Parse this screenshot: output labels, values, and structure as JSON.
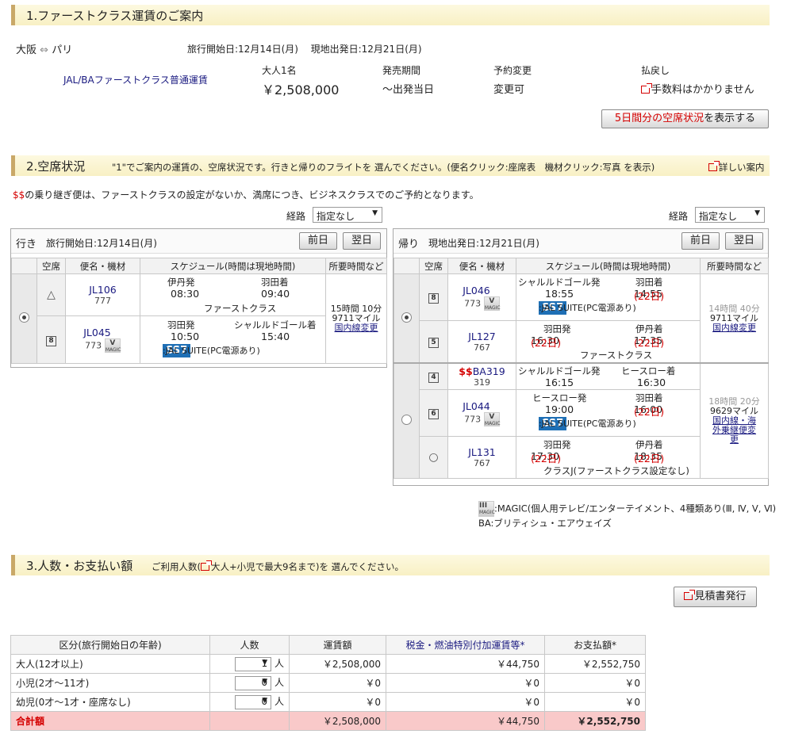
{
  "sections": {
    "s1": {
      "title": "1.ファーストクラス運賃のご案内"
    },
    "s2": {
      "title": "2.空席状況",
      "instruction": "\"1\"でご案内の運賃の、空席状況です。行きと帰りのフライトを 選んでください。(便名クリック:座席表　機材クリック:写真 を表示)",
      "details_link": "詳しい案内"
    },
    "s3": {
      "title": "3.人数・お支払い額",
      "note_pre": "ご利用人数(",
      "note_link": "大人+小児で最大9名まで",
      "note_post": ")を 選んでください。"
    }
  },
  "route": {
    "from": "大阪",
    "arrow": "⇔",
    "to": "パリ"
  },
  "dates": {
    "depart_label": "旅行開始日:",
    "depart": "12月14日(月)",
    "return_label": "現地出発日:",
    "return": "12月21日(月)"
  },
  "fare": {
    "name": "JAL/BAファーストクラス普通運賃",
    "col1_label": "大人1名",
    "col1_value": "￥2,508,000",
    "col2_label": "発売期間",
    "col2_value": "～出発当日",
    "col3_label": "予約変更",
    "col3_value": "変更可",
    "col4_label": "払戻し",
    "col4_value": "手数料はかかりません"
  },
  "availability_button": {
    "label_red": "5日間分の空席状況",
    "label_rest": "を表示する"
  },
  "notice": {
    "marks": "$$",
    "text": "の乗り継ぎ便は、ファーストクラスの設定がないか、満席につき、ビジネスクラスでのご予約となります。"
  },
  "route_filter": {
    "label": "経路",
    "value": "指定なし"
  },
  "outbound": {
    "title": "行き",
    "date_label": "旅行開始日:12月14日(月)",
    "prev": "前日",
    "next": "翌日",
    "headers": [
      "空席",
      "便名・機材",
      "スケジュール(時間は現地時間)",
      "所要時間など"
    ],
    "flights": [
      {
        "seat": "△",
        "no": "JL106",
        "ac": "777",
        "dep": "伊丹発",
        "dep_time": "08:30",
        "arr": "羽田着",
        "arr_time": "09:40",
        "class": "ファーストクラス"
      },
      {
        "seat": "8",
        "no": "JL045",
        "ac": "773",
        "dep": "羽田発",
        "dep_time": "10:50",
        "arr": "シャルルドゴール着",
        "arr_time": "15:40",
        "class": ":JAL SUITE(PC電源あり)"
      }
    ],
    "duration": "15時間 10分",
    "miles": "9711マイル",
    "change": "国内線変更"
  },
  "inbound": {
    "title": "帰り",
    "date_label": "現地出発日:12月21日(月)",
    "prev": "前日",
    "next": "翌日",
    "headers": [
      "空席",
      "便名・機材",
      "スケジュール(時間は現地時間)",
      "所要時間など"
    ],
    "option1": {
      "flights": [
        {
          "seat": "8",
          "no": "JL046",
          "ac": "773",
          "dep": "シャルルドゴール発",
          "dep_time": "18:55",
          "arr": "羽田着",
          "arr_time": "14:55",
          "arr_day": "(22日)",
          "class": ":JAL SUITE(PC電源あり)"
        },
        {
          "seat": "5",
          "no": "JL127",
          "ac": "767",
          "dep": "羽田発",
          "dep_time": "16:30",
          "dep_day": "(22日)",
          "arr": "伊丹着",
          "arr_time": "17:35",
          "arr_day": "(22日)",
          "class": "ファーストクラス"
        }
      ],
      "duration": "14時間 40分",
      "miles": "9711マイル",
      "change": "国内線変更"
    },
    "option2": {
      "flights": [
        {
          "seat": "4",
          "marks": "$$",
          "no": "BA319",
          "ac": "319",
          "dep": "シャルルドゴール発",
          "dep_time": "16:15",
          "arr": "ヒースロー着",
          "arr_time": "16:30"
        },
        {
          "seat": "6",
          "no": "JL044",
          "ac": "773",
          "dep": "ヒースロー発",
          "dep_time": "19:00",
          "arr": "羽田着",
          "arr_time": "16:00",
          "arr_day": "(22日)",
          "class": ":JAL SUITE(PC電源あり)"
        },
        {
          "seat": "○",
          "no": "JL131",
          "ac": "767",
          "dep": "羽田発",
          "dep_time": "17:30",
          "dep_day": "(22日)",
          "arr": "伊丹着",
          "arr_time": "18:35",
          "arr_day": "(22日)",
          "class": "クラスJ(ファーストクラス設定なし)"
        }
      ],
      "duration": "18時間 20分",
      "miles": "9629マイル",
      "change1": "国内線・海",
      "change2": "外乗継便変",
      "change3": "更"
    }
  },
  "icons": {
    "magic_top": "III",
    "magic_label": "MAGIC",
    "v_label": "V",
    "ss7": "SS7"
  },
  "legend": {
    "magic": ":MAGIC(個人用テレビ/エンターテイメント、4種類あり(Ⅲ, Ⅳ, Ⅴ, Ⅵ)",
    "ba": "BA:ブリティシュ・エアウェイズ"
  },
  "quote_button": "見積書発行",
  "pricing": {
    "headers": [
      "区分(旅行開始日の年齢)",
      "人数",
      "運賃額",
      "税金・燃油特別付加運賃等*",
      "お支払額*"
    ],
    "unit": "人",
    "rows": [
      {
        "label": "大人(12才以上)",
        "count": "1",
        "fare": "￥2,508,000",
        "tax": "￥44,750",
        "pay": "￥2,552,750"
      },
      {
        "label": "小児(2才～11才)",
        "count": "0",
        "fare": "￥0",
        "tax": "￥0",
        "pay": "￥0"
      },
      {
        "label": "幼児(0才～1才・座席なし)",
        "count": "0",
        "fare": "￥0",
        "tax": "￥0",
        "pay": "￥0"
      }
    ],
    "total": {
      "label": "合計額",
      "fare": "￥2,508,000",
      "tax": "￥44,750",
      "pay": "￥2,552,750"
    }
  },
  "colors": {
    "accent_red": "#d40000",
    "navy": "#1a1a80",
    "section_bar": "#f8f0c4",
    "total_row": "#f9c9c9"
  }
}
